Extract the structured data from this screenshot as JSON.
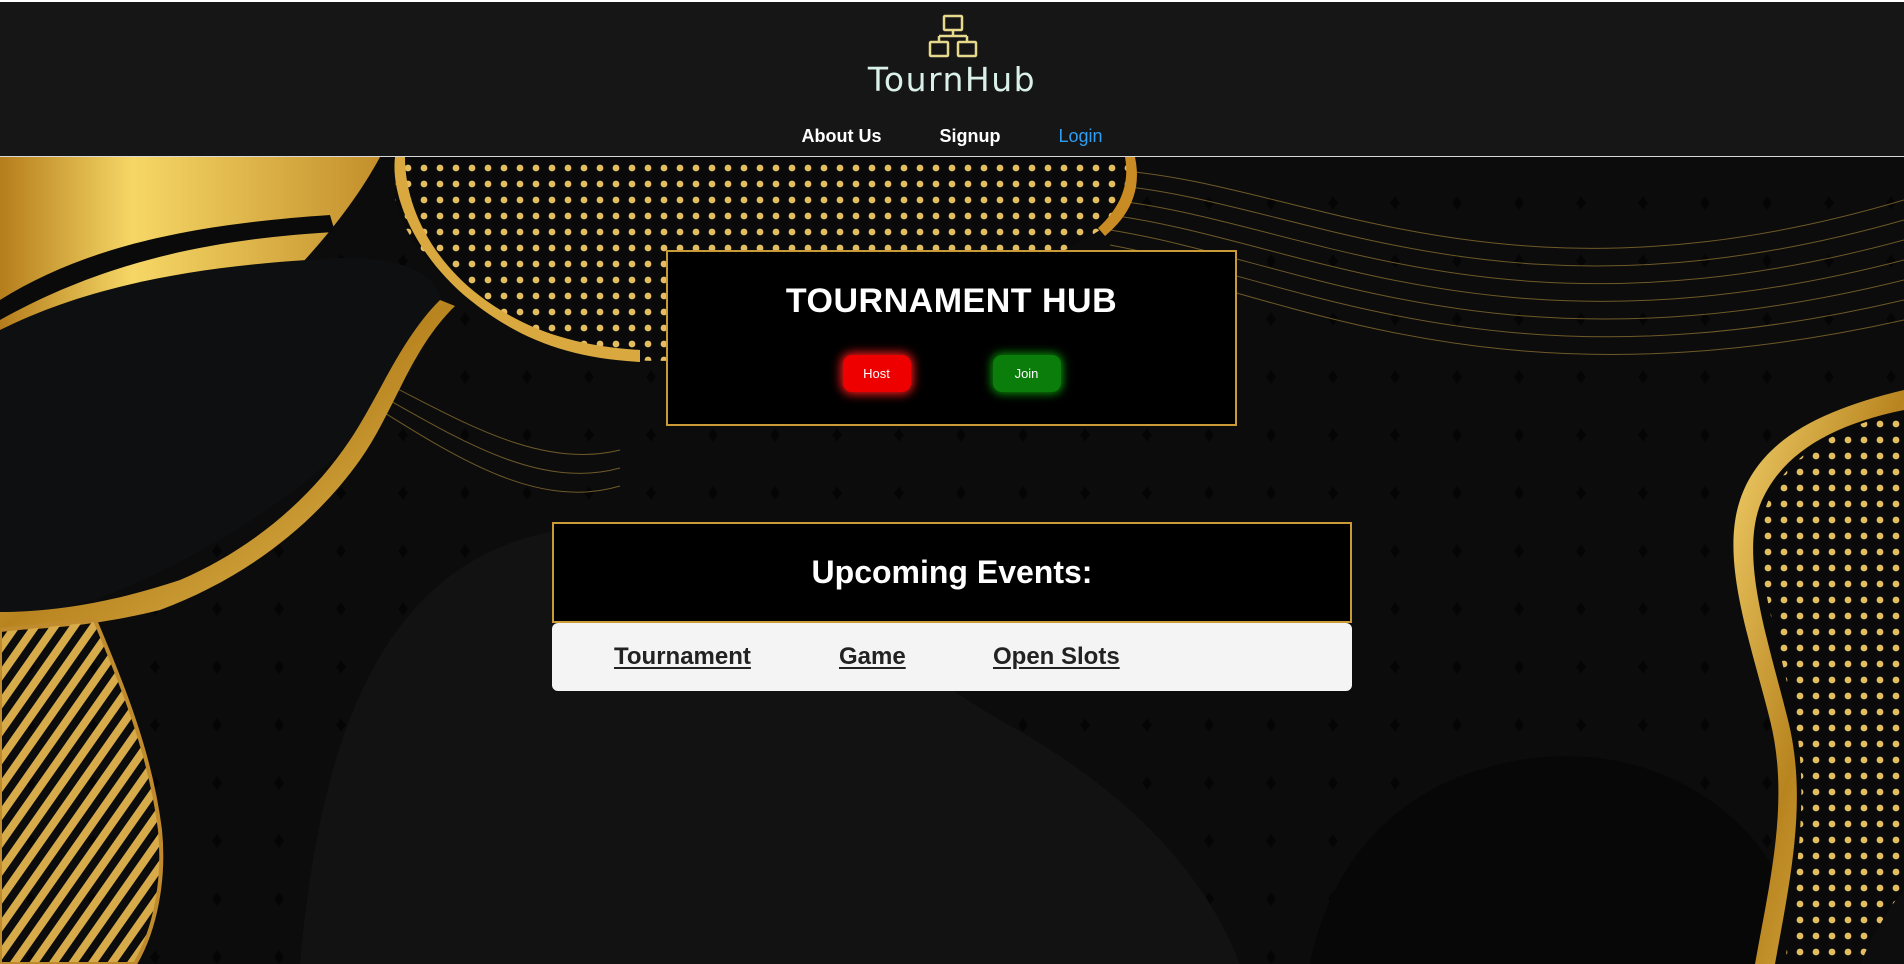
{
  "header": {
    "logo_text": "TournHub",
    "logo_icon": "network-hierarchy-icon",
    "nav": [
      {
        "label": "About Us"
      },
      {
        "label": "Signup"
      },
      {
        "label": "Login"
      }
    ]
  },
  "hub": {
    "title": "TOURNAMENT HUB",
    "host_label": "Host",
    "join_label": "Join"
  },
  "events": {
    "title": "Upcoming Events:",
    "columns": [
      "Tournament",
      "Game",
      "Open Slots"
    ]
  },
  "colors": {
    "accent_gold": "#c99a35",
    "host_red": "#ee0000",
    "join_green": "#0a7d0a",
    "login_blue": "#2d9ef2",
    "header_bg": "#161616"
  }
}
